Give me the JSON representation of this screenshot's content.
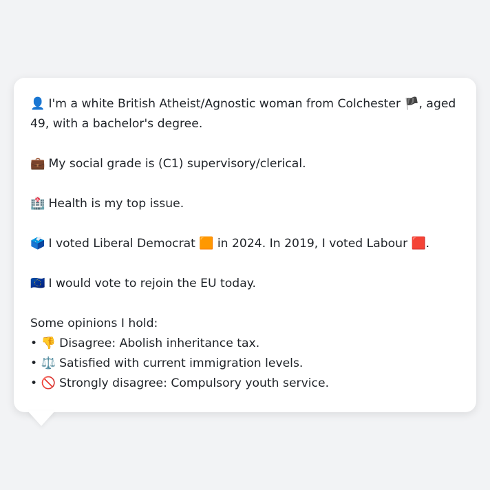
{
  "profile": {
    "intro_icon": "👤",
    "intro_text": "I'm a white British Atheist/Agnostic woman from Colchester",
    "intro_flag": "🏴",
    "intro_tail": ", aged 49, with a bachelor's degree.",
    "grade_icon": "💼",
    "grade_text": "My social grade is (C1) supervisory/clerical.",
    "health_icon": "🏥",
    "health_text": "Health is my top issue.",
    "vote_icon": "🗳️",
    "vote_text_1": "I voted Liberal Democrat",
    "vote_color_1": "🟧",
    "vote_text_2": "in 2024. In 2019, I voted Labour",
    "vote_color_2": "🟥",
    "vote_tail": ".",
    "eu_icon": "🇪🇺",
    "eu_text": "I would vote to rejoin the EU today."
  },
  "opinions": {
    "heading": "Some opinions I hold:",
    "items": [
      {
        "bullet": "•",
        "icon": "👎",
        "text": "Disagree: Abolish inheritance tax."
      },
      {
        "bullet": "•",
        "icon": "⚖️",
        "text": "Satisfied with current immigration levels."
      },
      {
        "bullet": "•",
        "icon": "🚫",
        "text": "Strongly disagree: Compulsory youth service."
      }
    ]
  },
  "colors": {
    "background": "#f2f3f5",
    "bubble": "#ffffff",
    "text": "#1f2328"
  }
}
